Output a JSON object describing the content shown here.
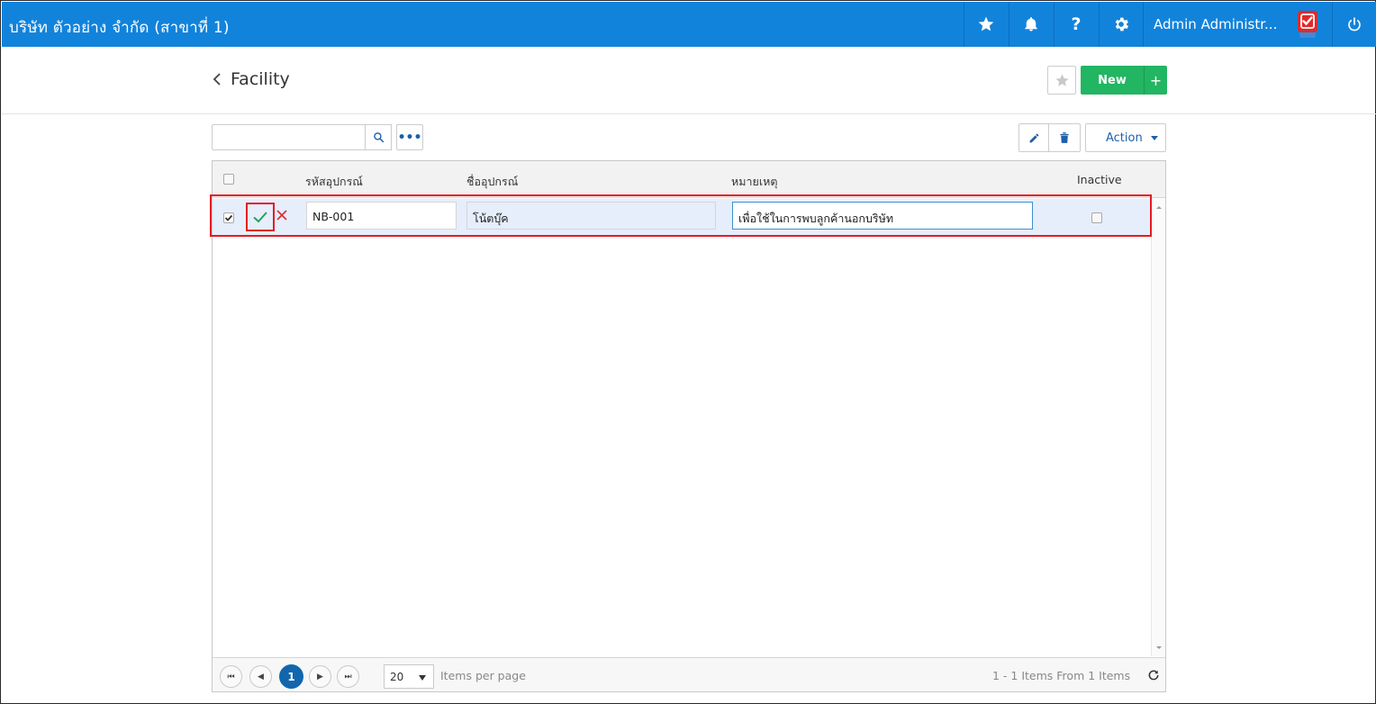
{
  "topbar": {
    "company": "บริษัท ตัวอย่าง จำกัด (สาขาที่ 1)",
    "user_name": "Admin Administr...",
    "icons": [
      "star-icon",
      "bell-icon",
      "help-icon",
      "gear-icon",
      "power-icon"
    ]
  },
  "page": {
    "title": "Facility",
    "new_label": "New",
    "plus_label": "+"
  },
  "toolbar": {
    "search_value": "",
    "more_label": "•••",
    "action_label": "Action"
  },
  "grid": {
    "columns": [
      "รหัสอุปกรณ์",
      "ชื่ออุปกรณ์",
      "หมายเหตุ",
      "Inactive"
    ],
    "rows": [
      {
        "checked": true,
        "code": "NB-001",
        "name": "โน้ตบุ๊ค",
        "note": "เพื่อใช้ในการพบลูกค้านอกบริษัท",
        "inactive": false
      }
    ]
  },
  "pager": {
    "current_page": "1",
    "page_size": "20",
    "items_per_page_label": "Items per page",
    "summary": "1 - 1 Items From 1 Items"
  },
  "colors": {
    "topbar": "#1283db",
    "new_button": "#22b562",
    "highlight_box": "#e31b23",
    "row_selected": "#e6eefb"
  }
}
